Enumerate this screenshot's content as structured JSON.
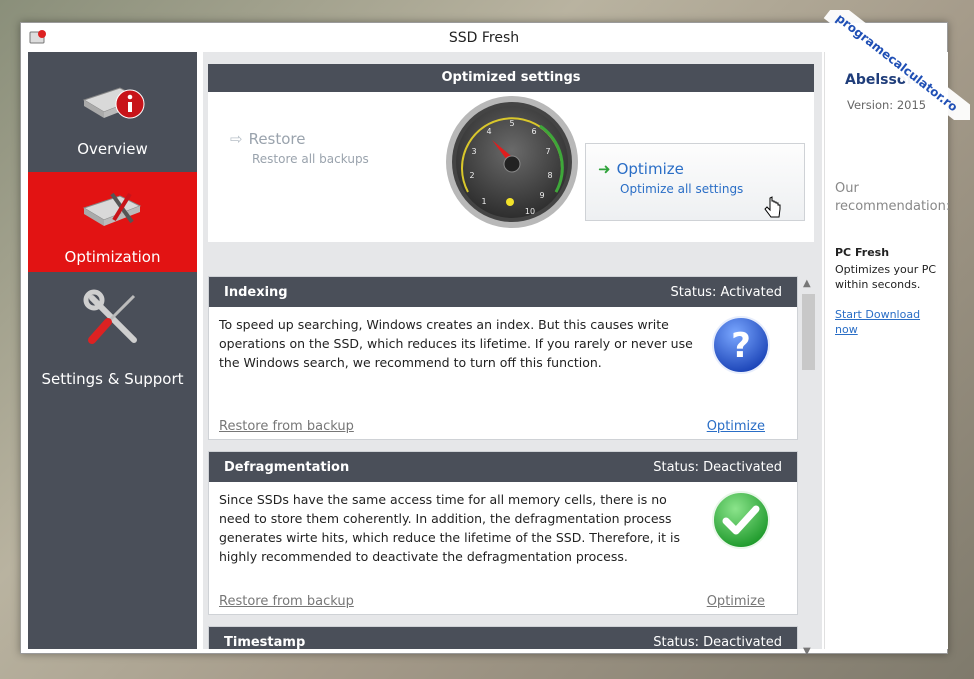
{
  "window": {
    "title": "SSD Fresh"
  },
  "watermark": {
    "text": "programecalculator.ro"
  },
  "sidebar": {
    "items": [
      {
        "label": "Overview",
        "icon": "ssd-info-icon",
        "active": false
      },
      {
        "label": "Optimization",
        "icon": "ssd-tools-icon",
        "active": true
      },
      {
        "label": "Settings & Support",
        "icon": "wrench-screwdriver-icon",
        "active": false
      }
    ]
  },
  "optimized_panel": {
    "header": "Optimized settings",
    "restore": {
      "label": "Restore",
      "sub": "Restore all backups"
    },
    "optimize": {
      "label": "Optimize",
      "sub": "Optimize all settings"
    },
    "gauge_ticks": [
      "1",
      "2",
      "3",
      "4",
      "5",
      "6",
      "7",
      "8",
      "9",
      "10"
    ]
  },
  "features": [
    {
      "title": "Indexing",
      "status": "Status: Activated",
      "description": "To speed up searching, Windows creates an index. But this causes write operations on the SSD, which reduces its lifetime. If you rarely or never use the Windows search, we recommend to turn off this function.",
      "restore_link": "Restore from backup",
      "optimize_link": "Optimize",
      "icon": "question-icon",
      "optimize_color": "#2a6ec6"
    },
    {
      "title": "Defragmentation",
      "status": "Status: Deactivated",
      "description": "Since SSDs have the same access time for all memory cells, there is no need to store them coherently. In addition, the defragmentation process generates wirte hits, which reduce the lifetime of the SSD. Therefore, it is highly recommended to deactivate the defragmentation process.",
      "restore_link": "Restore from backup",
      "optimize_link": "Optimize",
      "icon": "checkmark-icon",
      "optimize_color": "#777777"
    },
    {
      "title": "Timestamp",
      "status": "Status: Deactivated"
    }
  ],
  "right_panel": {
    "logo": "Abelssoft",
    "version": "Version: 2015",
    "recommendation": "Our recommendation:",
    "product": "PC Fresh",
    "product_desc": "Optimizes your PC within seconds.",
    "download": "Start Download now"
  },
  "colors": {
    "accent_red": "#e21313",
    "sidebar_bg": "#4a4f59",
    "link_blue": "#2a6ec6"
  }
}
